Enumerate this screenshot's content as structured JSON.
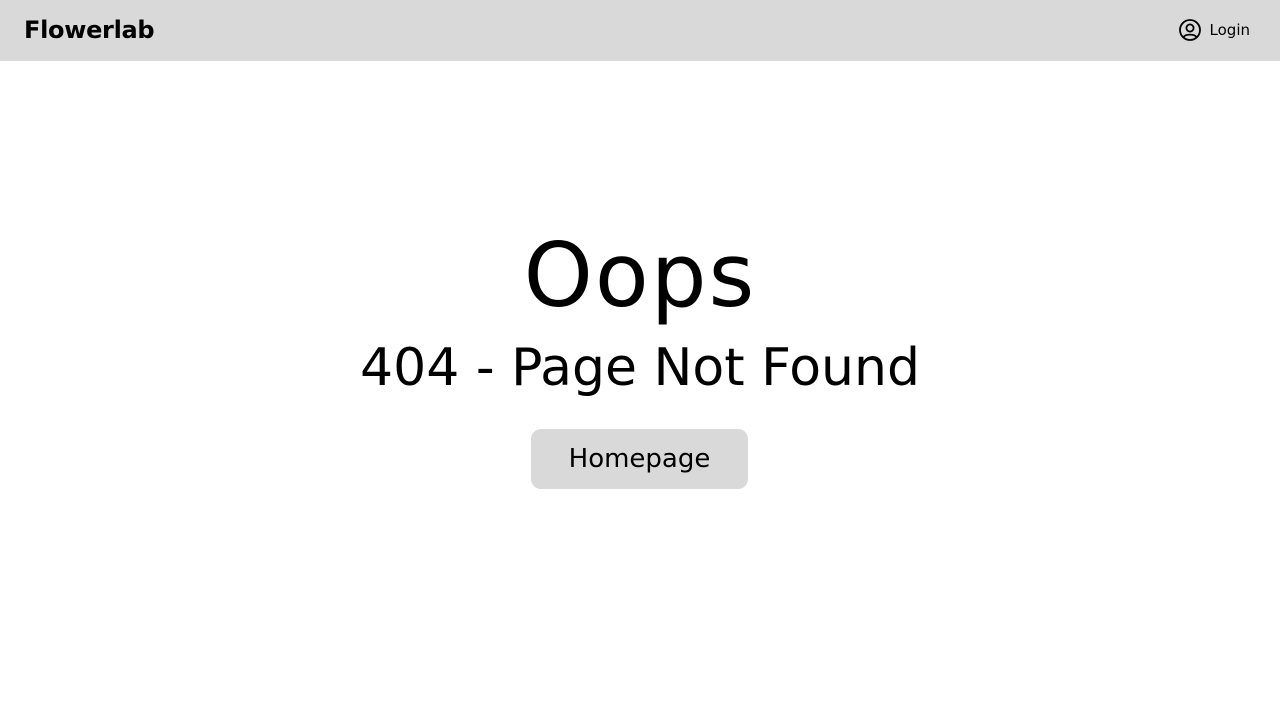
{
  "header": {
    "brand": "Flowerlab",
    "login_label": "Login",
    "login_icon": "user-circle-icon",
    "background": "#d9d9d9"
  },
  "main": {
    "heading": "Oops",
    "subtitle": "404 - Page Not Found",
    "home_button_label": "Homepage",
    "button_background": "#d9d9d9"
  }
}
